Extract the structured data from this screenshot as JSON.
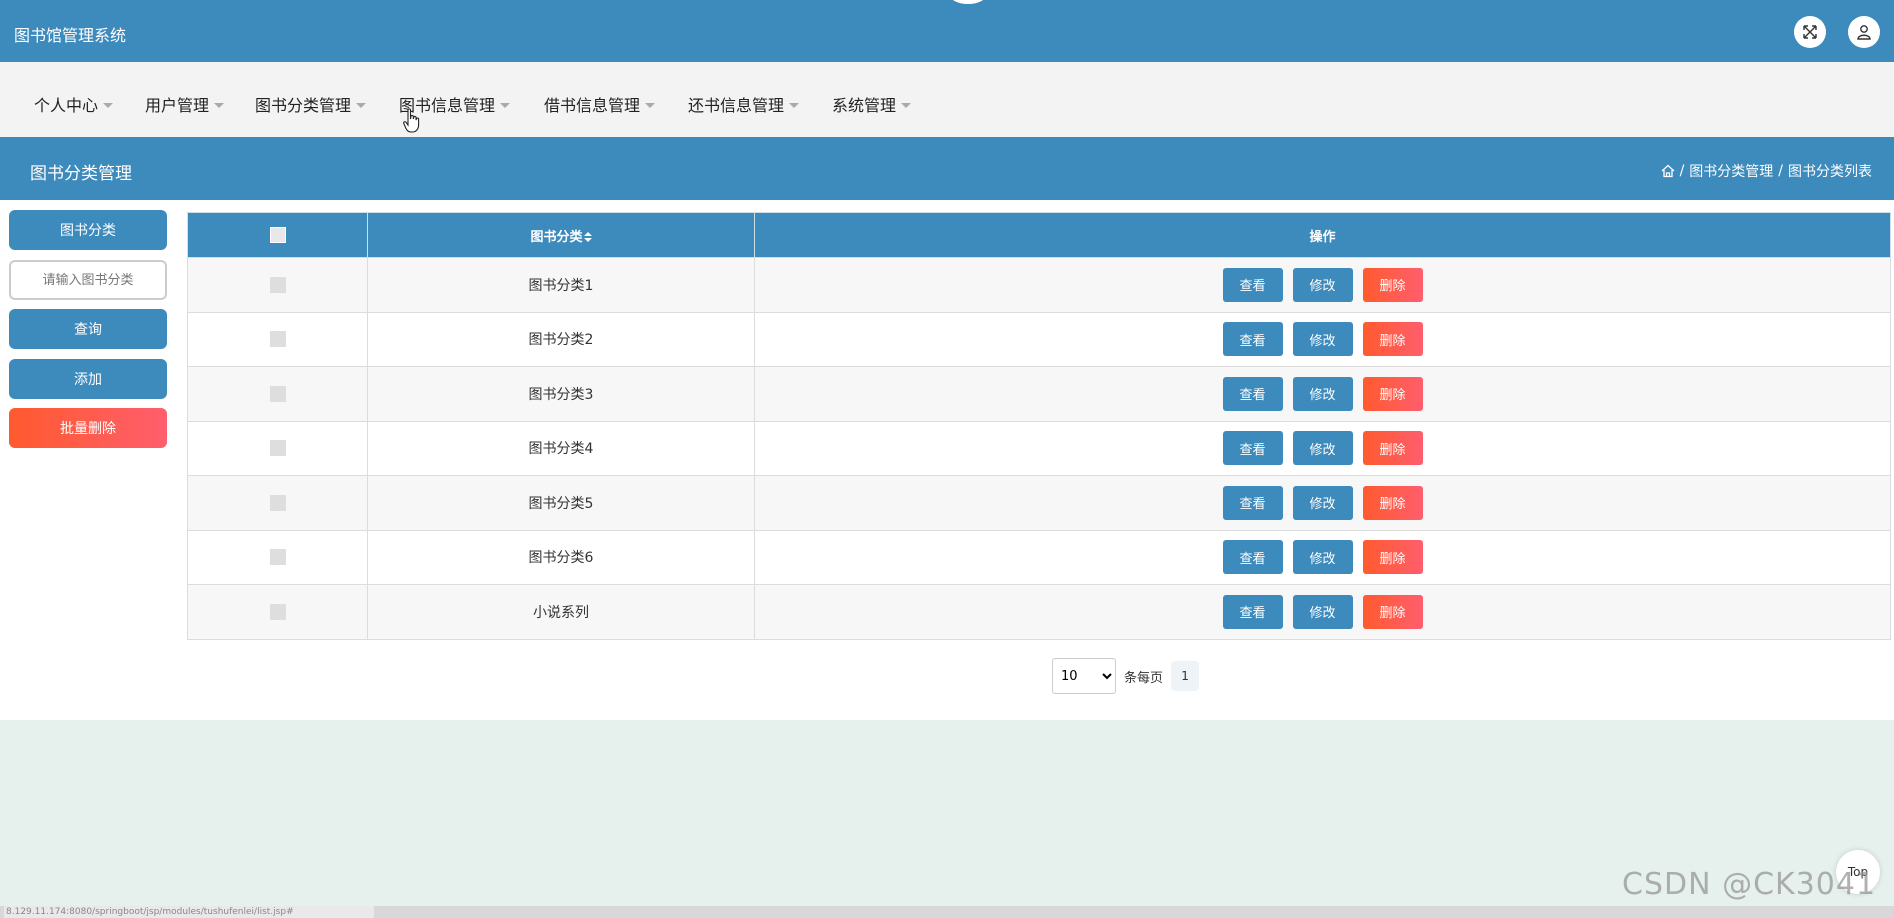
{
  "header": {
    "app_title": "图书馆管理系统",
    "fullscreen_icon": "expand-arrows-icon",
    "user_icon": "user-icon"
  },
  "nav": {
    "items": [
      {
        "label": "个人中心"
      },
      {
        "label": "用户管理"
      },
      {
        "label": "图书分类管理"
      },
      {
        "label": "图书信息管理"
      },
      {
        "label": "借书信息管理"
      },
      {
        "label": "还书信息管理"
      },
      {
        "label": "系统管理"
      }
    ]
  },
  "title_bar": {
    "page_title": "图书分类管理",
    "breadcrumb": {
      "home_icon": "home-icon",
      "items": [
        "图书分类管理",
        "图书分类列表"
      ],
      "separator": "/"
    }
  },
  "sidebar": {
    "category_label": "图书分类",
    "search_placeholder": "请输入图书分类",
    "search_value": "",
    "query_button": "查询",
    "add_button": "添加",
    "batch_delete_button": "批量删除"
  },
  "table": {
    "headers": {
      "name": "图书分类",
      "sort_icon": "sort-icon",
      "actions": "操作"
    },
    "actions": {
      "view": "查看",
      "edit": "修改",
      "delete": "删除"
    },
    "rows": [
      {
        "name": "图书分类1"
      },
      {
        "name": "图书分类2"
      },
      {
        "name": "图书分类3"
      },
      {
        "name": "图书分类4"
      },
      {
        "name": "图书分类5"
      },
      {
        "name": "图书分类6"
      },
      {
        "name": "小说系列"
      }
    ]
  },
  "pager": {
    "page_size": "10",
    "page_size_options": [
      "10"
    ],
    "per_page_label": "条每页",
    "current_page": "1"
  },
  "back_to_top": "Top",
  "watermark": "CSDN @CK3041",
  "status_url": "8.129.11.174:8080/springboot/jsp/modules/tushufenlei/list.jsp#",
  "colors": {
    "primary": "#3d8abd",
    "danger": "#ff5a2e",
    "background": "#e6f1ee"
  }
}
